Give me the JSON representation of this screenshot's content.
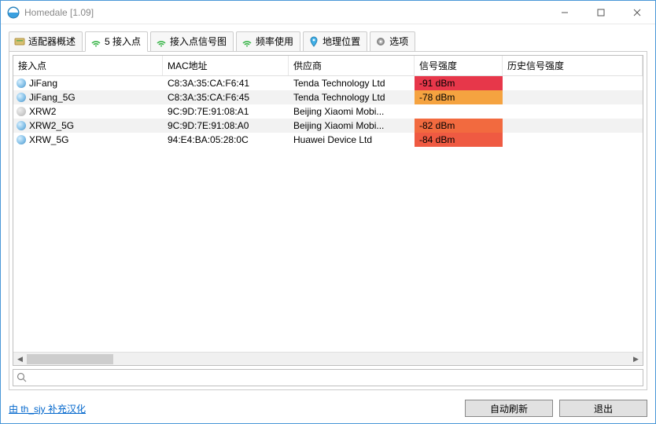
{
  "window": {
    "title": "Homedale [1.09]"
  },
  "tabs": [
    {
      "label": "适配器概述",
      "icon": "card"
    },
    {
      "label": "5 接入点",
      "icon": "wifi-green",
      "active": true
    },
    {
      "label": "接入点信号图",
      "icon": "wifi-green"
    },
    {
      "label": "频率使用",
      "icon": "wifi-green"
    },
    {
      "label": "地理位置",
      "icon": "pin"
    },
    {
      "label": "选项",
      "icon": "gear"
    }
  ],
  "columns": [
    "接入点",
    "MAC地址",
    "供应商",
    "信号强度",
    "历史信号强度"
  ],
  "rows": [
    {
      "ap": "JiFang",
      "icon": "blue",
      "mac": "C8:3A:35:CA:F6:41",
      "vendor": "Tenda Technology Ltd",
      "signal": "-91 dBm",
      "sig_color": "#e7374a"
    },
    {
      "ap": "JiFang_5G",
      "icon": "blue",
      "mac": "C8:3A:35:CA:F6:45",
      "vendor": "Tenda Technology Ltd",
      "signal": "-78 dBm",
      "sig_color": "#f5a340"
    },
    {
      "ap": "XRW2",
      "icon": "grey",
      "mac": "9C:9D:7E:91:08:A1",
      "vendor": "Beijing Xiaomi Mobi...",
      "signal": "",
      "sig_color": ""
    },
    {
      "ap": "XRW2_5G",
      "icon": "blue",
      "mac": "9C:9D:7E:91:08:A0",
      "vendor": "Beijing Xiaomi Mobi...",
      "signal": "-82 dBm",
      "sig_color": "#f26a3f"
    },
    {
      "ap": "XRW_5G",
      "icon": "blue",
      "mac": "94:E4:BA:05:28:0C",
      "vendor": "Huawei Device Ltd",
      "signal": "-84 dBm",
      "sig_color": "#ef5a42"
    }
  ],
  "footer": {
    "link": "由 th_sjy 补充汉化",
    "auto_refresh": "自动刷新",
    "exit": "退出"
  },
  "search": {
    "placeholder": ""
  }
}
